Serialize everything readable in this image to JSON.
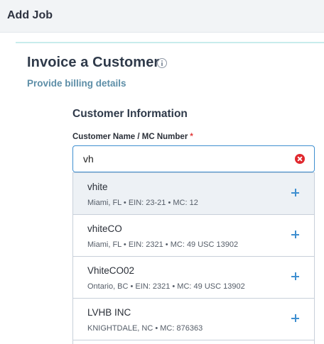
{
  "header": {
    "title": "Add Job"
  },
  "page": {
    "title": "Invoice a Customer",
    "subtitle": "Provide billing details"
  },
  "section": {
    "title": "Customer Information",
    "field_label": "Customer Name / MC Number",
    "required_mark": "*",
    "input_value": "vh"
  },
  "results": [
    {
      "name": "vhite",
      "detail": "Miami, FL • EIN: 23-21 • MC: 12"
    },
    {
      "name": "vhiteCO",
      "detail": "Miami, FL • EIN: 2321 • MC: 49 USC 13902"
    },
    {
      "name": "VhiteCO02",
      "detail": "Ontario, BC • EIN: 2321 • MC: 49 USC 13902"
    },
    {
      "name": "LVHB INC",
      "detail": "KNIGHTDALE, NC • MC: 876363"
    }
  ],
  "colors": {
    "accent": "#3f8fd0",
    "clear": "#e0282e",
    "subtitle": "#5d8ea7"
  },
  "icons": {
    "info": "info-icon",
    "clear": "clear-icon",
    "add": "plus-icon"
  }
}
